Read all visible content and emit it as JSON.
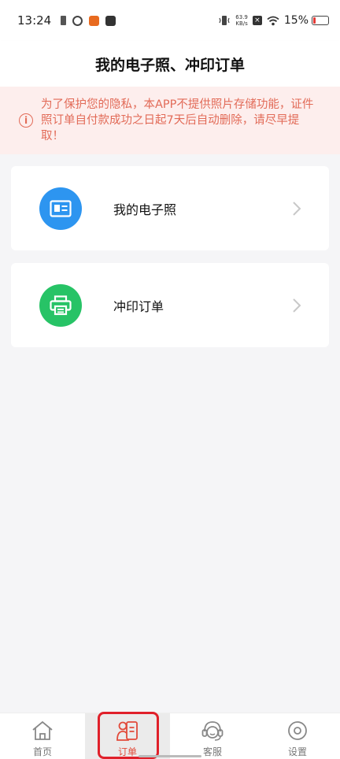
{
  "status_bar": {
    "time": "13:24",
    "net_speed_value": "63.9",
    "net_speed_unit": "KB/s",
    "battery_percent": "15%"
  },
  "header": {
    "title": "我的电子照、冲印订单"
  },
  "notice": {
    "text": "为了保护您的隐私，本APP不提供照片存储功能，证件照订单自付款成功之日起7天后自动删除，请尽早提取！",
    "color": "#e26b58",
    "background": "#fdeeed"
  },
  "cards": [
    {
      "label": "我的电子照",
      "icon": "id-card-icon",
      "icon_color": "#2d95f0"
    },
    {
      "label": "冲印订单",
      "icon": "printer-icon",
      "icon_color": "#27c366"
    }
  ],
  "bottom_nav": {
    "items": [
      {
        "label": "首页",
        "icon": "home-icon"
      },
      {
        "label": "订单",
        "icon": "order-icon",
        "active": true
      },
      {
        "label": "客服",
        "icon": "headset-icon"
      },
      {
        "label": "设置",
        "icon": "settings-icon"
      }
    ],
    "active_color": "#e24b3b"
  }
}
